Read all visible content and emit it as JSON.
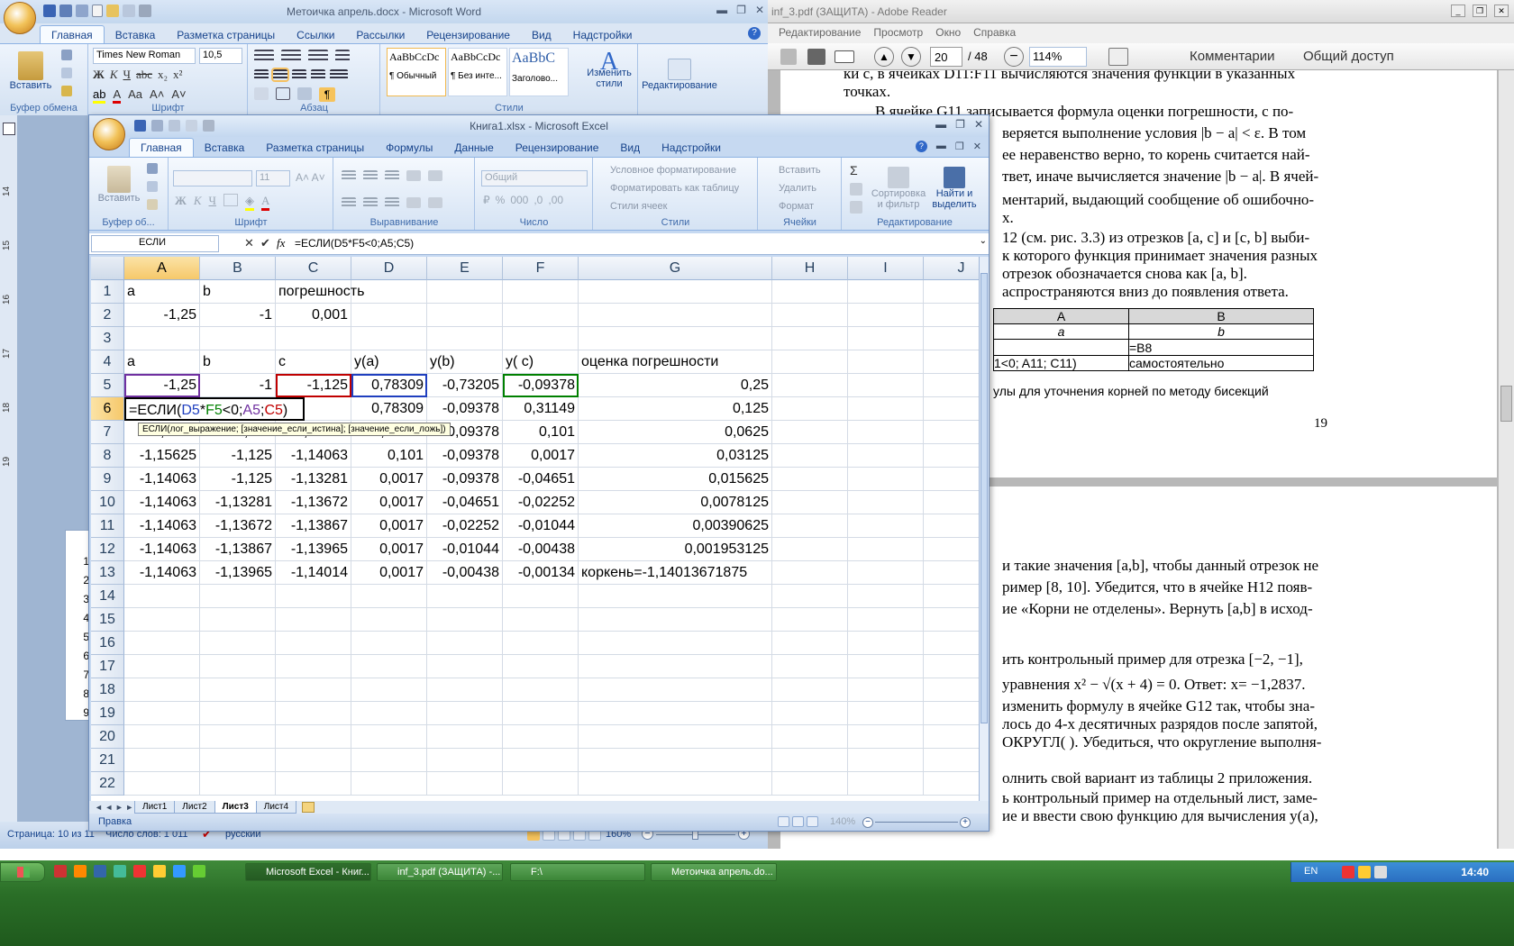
{
  "word": {
    "title": "Метоичка апрель.docx - Microsoft Word",
    "tabs": [
      "Главная",
      "Вставка",
      "Разметка страницы",
      "Ссылки",
      "Рассылки",
      "Рецензирование",
      "Вид",
      "Надстройки"
    ],
    "paste_label": "Вставить",
    "clipboard_label": "Буфер обмена",
    "font_group_label": "Шрифт",
    "paragraph_group_label": "Абзац",
    "styles_group_label": "Стили",
    "font_name": "Times New Roman",
    "font_size": "10,5",
    "styles": [
      {
        "preview": "AaBbCcDc",
        "name": "¶ Обычный"
      },
      {
        "preview": "AaBbCcDc",
        "name": "¶ Без инте..."
      },
      {
        "preview": "AaBbC",
        "name": "Заголово..."
      }
    ],
    "change_styles_label": "Изменить стили",
    "editing_label": "Редактирование",
    "status": {
      "page": "Страница: 10 из 11",
      "words": "Число слов: 1 011",
      "lang": "русский",
      "zoom": "160%"
    },
    "ruler_numbers": [
      "14",
      "15",
      "16",
      "17",
      "18",
      "19"
    ]
  },
  "pdf": {
    "title": "inf_3.pdf (ЗАЩИТА) - Adobe Reader",
    "menu": [
      "Редактирование",
      "Просмотр",
      "Окно",
      "Справка"
    ],
    "page_current": "20",
    "page_total": "/ 48",
    "zoom": "114%",
    "comments_label": "Комментарии",
    "share_label": "Общий доступ",
    "page1_lines": [
      "ки c, в ячейках D11:F11 вычисляются значения функции в указанных",
      "точках.",
      "В ячейке G11 записывается формула оценки погрешности, с по-",
      "веряется выполнение условия |b − a| < ε. В том",
      "ее неравенство верно, то корень считается най-",
      "твет, иначе вычисляется значение |b − a|. В ячей-",
      "ментарий, выдающий сообщение об ошибочно-",
      "х.",
      "12 (см. рис. 3.3) из отрезков [a, c] и [c, b] выби-",
      "к которого функция принимает значения разных",
      "отрезок обозначается снова как [a, b].",
      "аспространяются вниз до появления ответа."
    ],
    "table": {
      "headers": [
        "A",
        "B"
      ],
      "row1": [
        "a",
        "b"
      ],
      "row2": [
        "",
        "=B8"
      ],
      "row3": [
        "1<0; A11; C11)",
        "самостоятельно"
      ]
    },
    "caption": "улы для уточнения корней по методу бисекций",
    "page_number": "19",
    "page2_lines": [
      "и такие значения [a,b], чтобы данный отрезок не",
      "ример [8, 10]. Убедится, что в ячейке H12 появ-",
      "ие «Корни не отделены». Вернуть [a,b] в исход-",
      "ить контрольный пример для отрезка [−2, −1],",
      "уравнения x² − √(x + 4) = 0. Ответ: x= −1,2837.",
      "изменить формулу в ячейке G12 так, чтобы зна-",
      "лось до 4-х десятичных разрядов после запятой,",
      "ОКРУГЛ( ). Убедиться, что округление выполня-",
      "олнить свой вариант из таблицы 2 приложения.",
      "ь контрольный пример на отдельный лист, заме-",
      "ие и ввести свою функцию для вычисления y(a),"
    ]
  },
  "excel": {
    "title": "Книга1.xlsx - Microsoft Excel",
    "tabs": [
      "Главная",
      "Вставка",
      "Разметка страницы",
      "Формулы",
      "Данные",
      "Рецензирование",
      "Вид",
      "Надстройки"
    ],
    "groups": {
      "clipboard": "Буфер об...",
      "font": "Шрифт",
      "alignment": "Выравнивание",
      "number": "Число",
      "styles": "Стили",
      "cells": "Ячейки",
      "editing": "Редактирование"
    },
    "paste_label": "Вставить",
    "number_format": "Общий",
    "font_size": "11",
    "styles_items": [
      "Условное форматирование",
      "Форматировать как таблицу",
      "Стили ячеек"
    ],
    "cells_items": [
      "Вставить",
      "Удалить",
      "Формат"
    ],
    "sort_label": "Сортировка и фильтр",
    "find_label": "Найти и выделить",
    "name_box": "ЕСЛИ",
    "formula": "=ЕСЛИ(D5*F5<0;A5;C5)",
    "tooltip": "ЕСЛИ(лог_выражение; [значение_если_истина]; [значение_если_ложь])",
    "columns": [
      "A",
      "B",
      "C",
      "D",
      "E",
      "F",
      "G",
      "H",
      "I",
      "J"
    ],
    "rows": [
      [
        "a",
        "b",
        "погрешность",
        "",
        "",
        "",
        "",
        "",
        "",
        ""
      ],
      [
        "-1,25",
        "-1",
        "0,001",
        "",
        "",
        "",
        "",
        "",
        "",
        ""
      ],
      [
        "",
        "",
        "",
        "",
        "",
        "",
        "",
        "",
        "",
        ""
      ],
      [
        "a",
        "b",
        "c",
        "y(a)",
        "y(b)",
        "y( c)",
        "оценка погрешности",
        "",
        "",
        ""
      ],
      [
        "-1,25",
        "-1",
        "-1,125",
        "0,78309",
        "-0,73205",
        "-0,09378",
        "0,25",
        "",
        "",
        ""
      ],
      [
        "=ЕСЛИ(D5*F5<0;A5;C5)",
        "",
        "",
        "0,78309",
        "-0,09378",
        "0,31149",
        "0,125",
        "",
        "",
        ""
      ],
      [
        "-1,1875",
        "-1,125",
        "-1,15625",
        "0,31149",
        "-0,09378",
        "0,101",
        "0,0625",
        "",
        "",
        ""
      ],
      [
        "-1,15625",
        "-1,125",
        "-1,14063",
        "0,101",
        "-0,09378",
        "0,0017",
        "0,03125",
        "",
        "",
        ""
      ],
      [
        "-1,14063",
        "-1,125",
        "-1,13281",
        "0,0017",
        "-0,09378",
        "-0,04651",
        "0,015625",
        "",
        "",
        ""
      ],
      [
        "-1,14063",
        "-1,13281",
        "-1,13672",
        "0,0017",
        "-0,04651",
        "-0,02252",
        "0,0078125",
        "",
        "",
        ""
      ],
      [
        "-1,14063",
        "-1,13672",
        "-1,13867",
        "0,0017",
        "-0,02252",
        "-0,01044",
        "0,00390625",
        "",
        "",
        ""
      ],
      [
        "-1,14063",
        "-1,13867",
        "-1,13965",
        "0,0017",
        "-0,01044",
        "-0,00438",
        "0,001953125",
        "",
        "",
        ""
      ],
      [
        "-1,14063",
        "-1,13965",
        "-1,14014",
        "0,0017",
        "-0,00438",
        "-0,00134",
        "коркень=-1,14013671875",
        "",
        "",
        ""
      ],
      [
        "",
        "",
        "",
        "",
        "",
        "",
        "",
        "",
        "",
        ""
      ],
      [
        "",
        "",
        "",
        "",
        "",
        "",
        "",
        "",
        "",
        ""
      ],
      [
        "",
        "",
        "",
        "",
        "",
        "",
        "",
        "",
        "",
        ""
      ],
      [
        "",
        "",
        "",
        "",
        "",
        "",
        "",
        "",
        "",
        ""
      ],
      [
        "",
        "",
        "",
        "",
        "",
        "",
        "",
        "",
        "",
        ""
      ],
      [
        "",
        "",
        "",
        "",
        "",
        "",
        "",
        "",
        "",
        ""
      ],
      [
        "",
        "",
        "",
        "",
        "",
        "",
        "",
        "",
        "",
        ""
      ],
      [
        "",
        "",
        "",
        "",
        "",
        "",
        "",
        "",
        "",
        ""
      ],
      [
        "",
        "",
        "",
        "",
        "",
        "",
        "",
        "",
        "",
        ""
      ]
    ],
    "sheets": [
      "Лист1",
      "Лист2",
      "Лист3",
      "Лист4"
    ],
    "status": "Правка",
    "zoom": "140%"
  },
  "taskbar": {
    "items": [
      "Microsoft Excel - Книг...",
      "inf_3.pdf (ЗАЩИТА) -...",
      "F:\\",
      "Метоичка апрель.do..."
    ],
    "lang": "EN",
    "clock": "14:40"
  }
}
